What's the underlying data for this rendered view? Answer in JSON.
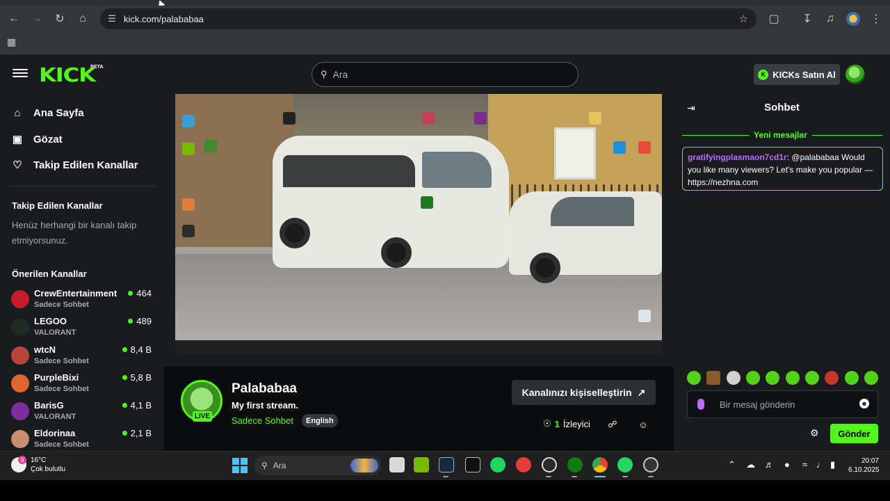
{
  "browser": {
    "url": "kick.com/palababaa",
    "icons": [
      "back-icon",
      "forward-icon",
      "reload-icon",
      "home-icon",
      "site-settings-icon",
      "bookmark-star-icon",
      "extensions-icon",
      "download-icon",
      "media-control-icon",
      "profile-icon",
      "menu-icon",
      "apps-icon"
    ]
  },
  "header": {
    "logo_text": "KICK",
    "logo_badge": "BETA",
    "search_placeholder": "Ara",
    "buy_kicks_label": "KICKs Satın Al",
    "brand_color": "#53fc18"
  },
  "sidebar": {
    "nav": [
      {
        "label": "Ana Sayfa",
        "icon": "home-icon"
      },
      {
        "label": "Gözat",
        "icon": "browse-icon"
      },
      {
        "label": "Takip Edilen Kanallar",
        "icon": "heart-icon"
      }
    ],
    "followed_title": "Takip Edilen Kanallar",
    "followed_empty": "Henüz herhangi bir kanalı takip etmiyorsunuz.",
    "recommended_title": "Önerilen Kanallar",
    "recommended": [
      {
        "name": "CrewEntertainment",
        "category": "Sadece Sohbet",
        "viewers": "464",
        "color": "#c81c2a"
      },
      {
        "name": "LEGOO",
        "category": "VALORANT",
        "viewers": "489",
        "color": "#1f2a22"
      },
      {
        "name": "wtcN",
        "category": "Sadece Sohbet",
        "viewers": "8,4 B",
        "color": "#b8443a"
      },
      {
        "name": "PurpleBixi",
        "category": "Sadece Sohbet",
        "viewers": "5,8 B",
        "color": "#e0662d"
      },
      {
        "name": "BarisG",
        "category": "VALORANT",
        "viewers": "4,1 B",
        "color": "#7e2d9c"
      },
      {
        "name": "Eldorinaa",
        "category": "Sadece Sohbet",
        "viewers": "2,1 B",
        "color": "#c98f72"
      }
    ]
  },
  "stream": {
    "channel_name": "Palababaa",
    "live_label": "LIVE",
    "title": "My first stream.",
    "category": "Sadece Sohbet",
    "language": "English",
    "customize_label": "Kanalınızı kişiselleştirin",
    "viewer_count": "1",
    "viewer_label": "İzleyici"
  },
  "chat": {
    "title": "Sohbet",
    "new_messages_label": "Yeni mesajlar",
    "messages": [
      {
        "user": "gratifyingplasmaon7cd1r",
        "text": ": @palababaa Would you like many viewers? Let's make you popular — https://nezhna.com"
      }
    ],
    "emote_colors": [
      "#53d21a",
      "#8a5a2b",
      "#d0d0d0",
      "#53d21a",
      "#53d21a",
      "#53d21a",
      "#53d21a",
      "#c0392b",
      "#53d21a",
      "#53d21a"
    ],
    "input_placeholder": "Bir mesaj gönderin",
    "send_label": "Gönder"
  },
  "os_taskbar": {
    "weather_temp": "16°C",
    "weather_desc": "Çok bulutlu",
    "weather_badge": "3",
    "search_label": "Ara",
    "time": "20:07",
    "date": "6.10.2025",
    "apps": [
      "file-explorer-icon",
      "nvidia-icon",
      "steam-icon",
      "epic-games-icon",
      "spotify-icon",
      "youtube-music-icon",
      "obs-icon",
      "xbox-icon",
      "chrome-icon",
      "whatsapp-icon",
      "app-icon"
    ]
  }
}
